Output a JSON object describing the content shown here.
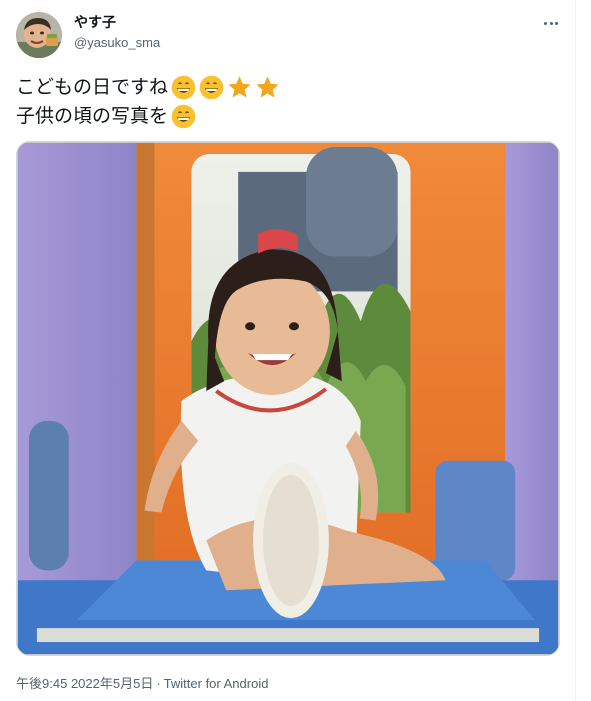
{
  "author": {
    "display_name": "やす子",
    "handle": "@yasuko_sma"
  },
  "tweet": {
    "line1": "こどもの日ですね",
    "line2": "子供の頃の写真を",
    "line1_emojis": [
      "grinning-face",
      "grinning-face",
      "star",
      "star"
    ],
    "line2_emojis": [
      "grinning-face"
    ]
  },
  "meta": {
    "time": "午後9:45",
    "date": "2022年5月5日",
    "separator": "·",
    "source": "Twitter for Android"
  },
  "colors": {
    "text_primary": "#0f1419",
    "text_secondary": "#536471",
    "border": "#cfd9de",
    "emoji_face": "#f9c02f",
    "emoji_star": "#f4a51c"
  },
  "icons": [
    "avatar",
    "more-icon",
    "grinning-face-emoji",
    "star-emoji",
    "tweet-photo"
  ]
}
